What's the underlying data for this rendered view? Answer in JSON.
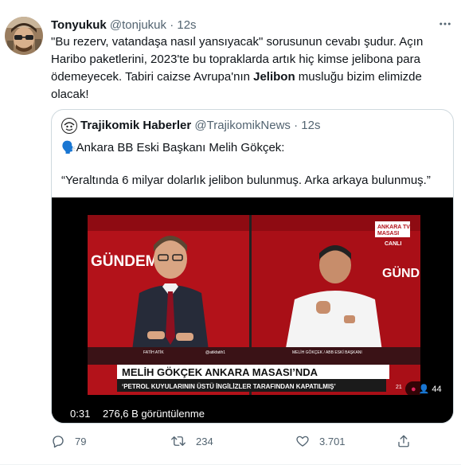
{
  "author": {
    "display_name": "Tonyukuk",
    "handle": "@tonjukuk",
    "separator": "·",
    "time": "12s"
  },
  "tweet": {
    "line1": "\"Bu rezerv, vatandaşa nasıl yansıyacak\" sorusunun cevabı şudur. Açın",
    "line2": "Haribo paketlerini, 2023'te bu topraklarda artık hiç kimse jelibona para",
    "line3": "ödemeyecek. Tabiri caizse Avrupa'nın ",
    "bold_word": "Jelibon",
    "line3_end": " musluğu bizim elimizde",
    "line4": "olacak!"
  },
  "quoted": {
    "display_name": "Trajikomik Haberler",
    "handle": "@TrajikomikNews",
    "separator": "·",
    "time": "12s",
    "line1": "🗣️Ankara BB Eski Başkanı Melih Gökçek:",
    "line2": "“Yeraltında 6 milyar dolarlık jelibon bulunmuş. Arka arkaya bulunmuş.”"
  },
  "video": {
    "duration": "0:31",
    "views": "276,6 B görüntülenme",
    "viewer_count": "44",
    "channel_logo_line1": "ANKARA TV",
    "channel_logo_line2": "MASASI",
    "live_label": "CANLI",
    "gundem_left": "GÜNDEM",
    "gundem_right": "GÜND",
    "left_caption": "FATİH ATİK",
    "left_handle": "@atikfatih1",
    "right_caption": "MELİH GÖKÇEK / ABB ESKİ BAŞKANI",
    "headline": "MELİH GÖKÇEK ANKARA MASASI’NDA",
    "subheadline": "‘PETROL KUYULARININ ÜSTÜ İNGİLİZLER TARAFINDAN KAPATILMIŞ’",
    "ticker_num": "21"
  },
  "stats": {
    "replies": "79",
    "retweets": "234",
    "likes": "3.701"
  }
}
